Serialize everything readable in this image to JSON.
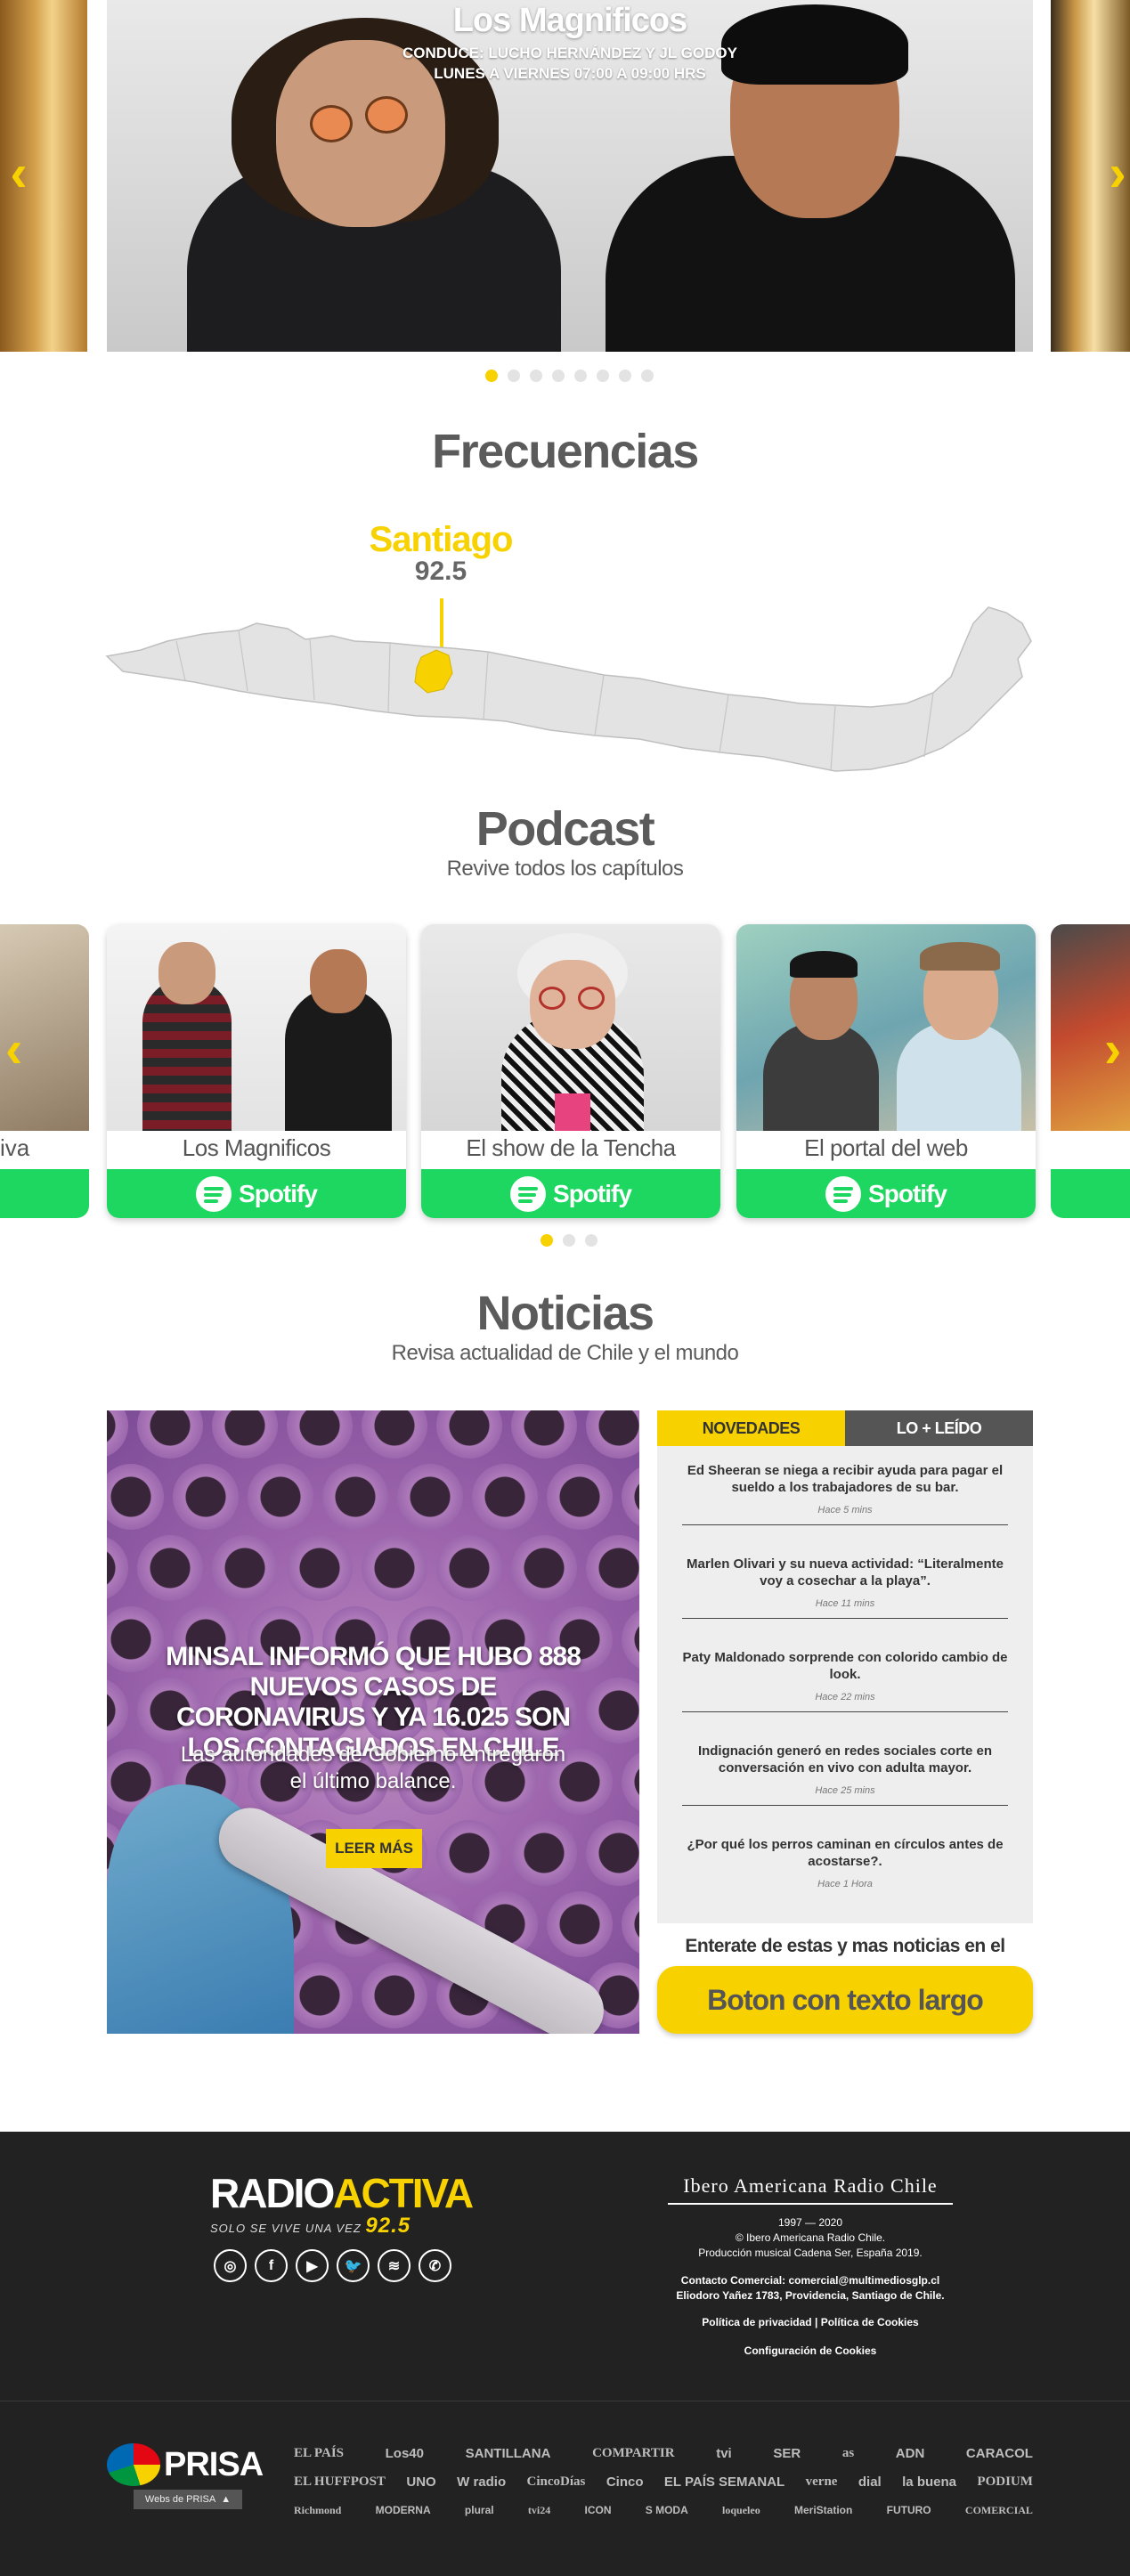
{
  "hero": {
    "title": "Los Magnificos",
    "host_line": "CONDUCE: LUCHO HERNÁNDEZ Y JL GODOY",
    "schedule_line": "LUNES A VIERNES 07:00 A 09:00 HRS",
    "dots_count": 8,
    "active_dot": 1
  },
  "frequencies": {
    "title": "Frecuencias",
    "city": "Santiago",
    "frequency": "92.5"
  },
  "podcast": {
    "title": "Podcast",
    "subtitle": "Revive todos los capítulos",
    "left_edge_label": "iva",
    "cards": [
      {
        "name": "Los Magnificos",
        "platform": "Spotify"
      },
      {
        "name": "El show de la Tencha",
        "platform": "Spotify"
      },
      {
        "name": "El portal del web",
        "platform": "Spotify"
      }
    ],
    "dots_count": 3,
    "active_dot": 1
  },
  "news": {
    "title": "Noticias",
    "subtitle": "Revisa actualidad de Chile y el mundo",
    "feature": {
      "headline": "MINSAL INFORMÓ QUE HUBO 888 NUEVOS CASOS DE CORONAVIRUS Y YA 16.025 SON LOS CONTAGIADOS EN CHILE",
      "lead": "Las autoridades de Gobierno entregaron el último balance.",
      "button": "LEER MÁS"
    },
    "tabs": {
      "active": "NOVEDADES",
      "inactive": "LO + LEÍDO"
    },
    "items": [
      {
        "title": "Ed Sheeran se niega a recibir ayuda para pagar el sueldo a los trabajadores de su bar.",
        "time": "Hace 5 mins"
      },
      {
        "title": "Marlen Olivari y su nueva actividad: “Literalmente voy a cosechar a la playa”.",
        "time": "Hace 11 mins"
      },
      {
        "title": "Paty Maldonado sorprende con colorido cambio de look.",
        "time": "Hace 22 mins"
      },
      {
        "title": "Indignación generó en redes sociales corte en conversación en vivo con adulta mayor.",
        "time": "Hace 25 mins"
      },
      {
        "title": "¿Por qué los perros caminan en círculos antes de acostarse?.",
        "time": "Hace 1 Hora"
      }
    ],
    "cta_text": "Enterate de estas y mas noticias en el",
    "cta_button": "Boton con texto largo"
  },
  "footer": {
    "brand_part1": "RADIO",
    "brand_part2": "ACTIVA",
    "brand_tagline": "SOLO SE VIVE UNA VEZ",
    "brand_freq": "92.5",
    "socials": [
      {
        "icon": "instagram-icon",
        "glyph": "◎"
      },
      {
        "icon": "facebook-icon",
        "glyph": "f"
      },
      {
        "icon": "youtube-icon",
        "glyph": "▶"
      },
      {
        "icon": "twitter-icon",
        "glyph": "🐦"
      },
      {
        "icon": "spotify-icon",
        "glyph": "≋"
      },
      {
        "icon": "whatsapp-icon",
        "glyph": "✆"
      }
    ],
    "company": "Ibero Americana Radio Chile",
    "years": "1997 — 2020",
    "copyright": "© Ibero Americana Radio Chile.",
    "production": "Producción musical Cadena Ser, España 2019.",
    "contact": "Contacto Comercial: comercial@multimediosglp.cl",
    "address": "Eliodoro Yañez 1783, Providencia, Santiago de Chile.",
    "privacy": "Política de privacidad",
    "separator": "|",
    "cookies_policy": "Política de Cookies",
    "cookies_config": "Configuración de Cookies",
    "prisa_name": "PRISA",
    "prisa_button": "Webs de PRISA",
    "brands_row1": [
      "EL PAÍS",
      "Los40",
      "SANTILLANA",
      "COMPARTIR",
      "tvi",
      "SER",
      "as",
      "ADN",
      "CARACOL"
    ],
    "brands_row2": [
      "EL HUFFPOST",
      "UNO",
      "W radio",
      "CincoDías",
      "Cinco",
      "EL PAÍS SEMANAL",
      "verne",
      "dial",
      "la buena",
      "PODIUM"
    ],
    "brands_row3": [
      "Richmond",
      "MODERNA",
      "plural",
      "tvi24",
      "ICON",
      "S MODA",
      "loqueleo",
      "MeriStation",
      "FUTURO",
      "COMERCIAL"
    ]
  }
}
